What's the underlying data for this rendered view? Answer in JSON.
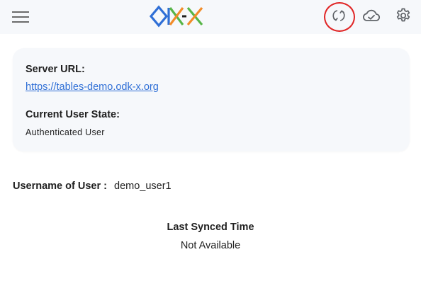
{
  "header": {
    "menu_icon": "hamburger-menu-icon",
    "logo_text": "ODK-X",
    "actions": [
      {
        "name": "sync",
        "icon": "sync-icon",
        "highlighted": true
      },
      {
        "name": "cloud",
        "icon": "cloud-icon"
      },
      {
        "name": "settings",
        "icon": "gear-icon"
      }
    ],
    "highlight_color": "#e02424"
  },
  "server": {
    "url_label": "Server URL:",
    "url": "https://tables-demo.odk-x.org",
    "state_label": "Current User State:",
    "state": "Authenticated User"
  },
  "user": {
    "label": "Username of User :",
    "value": "demo_user1"
  },
  "sync": {
    "title": "Last Synced Time",
    "value": "Not Available"
  },
  "colors": {
    "link": "#2f6fd6",
    "card_bg": "#f6f8fb",
    "logo_blue": "#2f6fd6",
    "logo_green": "#57b547",
    "logo_orange": "#f28c28",
    "logo_red": "#d9302c"
  }
}
